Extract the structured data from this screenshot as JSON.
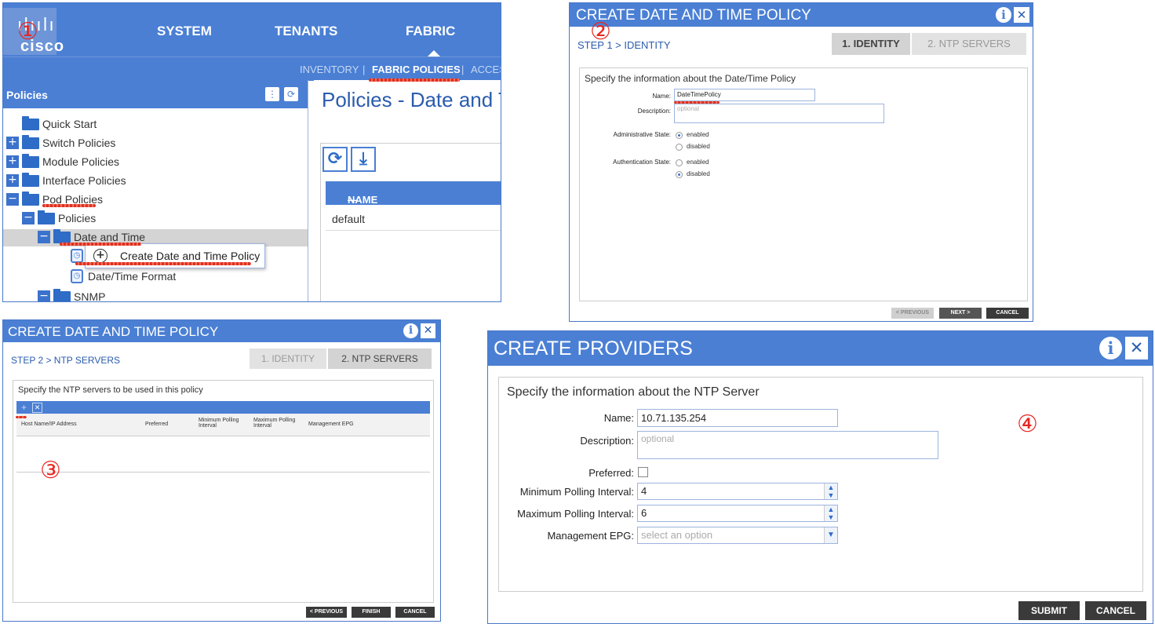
{
  "callouts": [
    "①",
    "②",
    "③",
    "④"
  ],
  "panel1": {
    "topnav": [
      "SYSTEM",
      "TENANTS",
      "FABRIC"
    ],
    "logo": "cisco",
    "subnav": {
      "inventory": "INVENTORY",
      "sep1": "|",
      "fabric_policies": "FABRIC POLICIES",
      "sep2": "|",
      "access": "ACCESS"
    },
    "left_header": "Policies",
    "tree": {
      "quick_start": "Quick Start",
      "switch_policies": "Switch Policies",
      "module_policies": "Module Policies",
      "interface_policies": "Interface Policies",
      "pod_policies": "Pod Policies",
      "policies": "Policies",
      "date_and_time": "Date and Time",
      "date_time_format": "Date/Time Format",
      "snmp": "SNMP"
    },
    "context_menu": "Create Date and Time Policy",
    "right_title": "Policies - Date and Time",
    "table_header": "NAME",
    "table_sort_glyph": "—",
    "table_rows": [
      "default"
    ]
  },
  "panel2": {
    "title": "CREATE DATE AND TIME POLICY",
    "breadcrumb": "STEP 1 > IDENTITY",
    "steps": [
      "1. IDENTITY",
      "2. NTP SERVERS"
    ],
    "section": "Specify the information about the Date/Time Policy",
    "name_label": "Name:",
    "name_value": "DateTimePolicy",
    "desc_label": "Description:",
    "desc_placeholder": "optional",
    "admin_label": "Administrative State:",
    "auth_label": "Authentication State:",
    "enabled": "enabled",
    "disabled": "disabled",
    "buttons": {
      "previous": "< PREVIOUS",
      "next": "NEXT >",
      "cancel": "CANCEL"
    }
  },
  "panel3": {
    "title": "CREATE DATE AND TIME POLICY",
    "breadcrumb": "STEP 2 > NTP SERVERS",
    "steps": [
      "1. IDENTITY",
      "2. NTP SERVERS"
    ],
    "section": "Specify the NTP servers to be used in this policy",
    "columns": [
      "Host Name/IP Address",
      "Preferred",
      "Minimum Polling Interval",
      "Maximum Polling Interval",
      "Management EPG"
    ],
    "buttons": {
      "previous": "< PREVIOUS",
      "finish": "FINISH",
      "cancel": "CANCEL"
    }
  },
  "panel4": {
    "title": "CREATE PROVIDERS",
    "section": "Specify the information about the NTP Server",
    "name_label": "Name:",
    "name_value": "10.71.135.254",
    "desc_label": "Description:",
    "desc_placeholder": "optional",
    "preferred_label": "Preferred:",
    "min_label": "Minimum Polling Interval:",
    "min_value": "4",
    "max_label": "Maximum Polling Interval:",
    "max_value": "6",
    "epg_label": "Management EPG:",
    "epg_placeholder": "select an option",
    "buttons": {
      "submit": "SUBMIT",
      "cancel": "CANCEL"
    }
  },
  "icons": {
    "info": "i",
    "close": "✕",
    "refresh": "⟳",
    "download": "⤓",
    "plus": "+",
    "minus": "−"
  },
  "colors": {
    "accent": "#4a7fd4",
    "dark_button": "#3a3a3a",
    "callout": "#e8261f"
  }
}
